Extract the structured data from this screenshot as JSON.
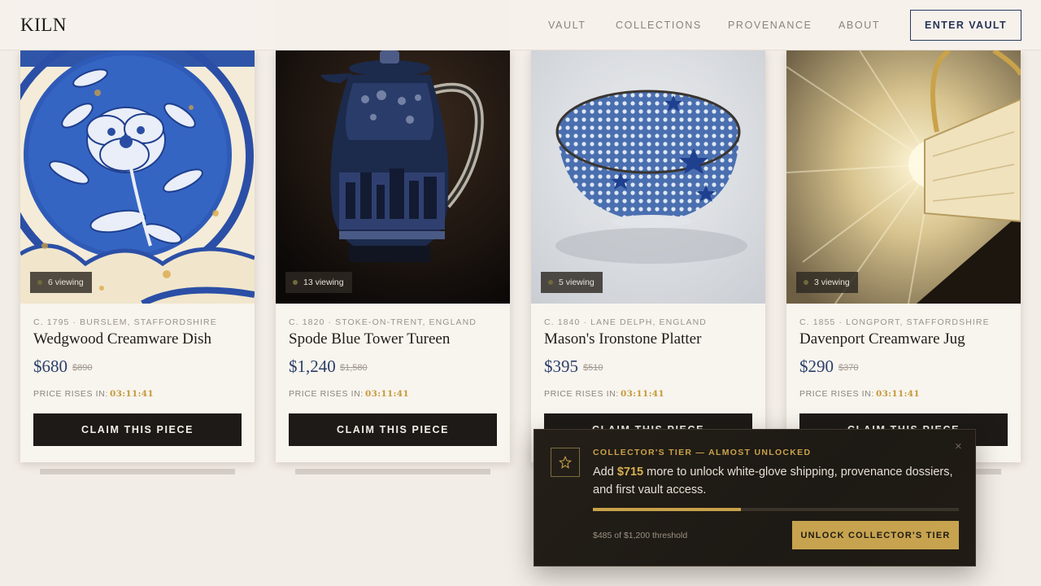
{
  "header": {
    "logo": "KILN",
    "nav": [
      "VAULT",
      "COLLECTIONS",
      "PROVENANCE",
      "ABOUT"
    ],
    "cta": "ENTER VAULT"
  },
  "cards": [
    {
      "image": "blue-white-floral-plate",
      "viewing": "6 viewing",
      "meta": "C. 1795 · BURSLEM, STAFFORDSHIRE",
      "title": "Wedgwood Creamware Dish",
      "price": "$680",
      "old_price": "$890",
      "rise_label": "PRICE RISES IN:",
      "timer": "03:11:41",
      "button": "CLAIM THIS PIECE"
    },
    {
      "image": "blue-white-castle-jug",
      "viewing": "13 viewing",
      "meta": "C. 1820 · STOKE-ON-TRENT, ENGLAND",
      "title": "Spode Blue Tower Tureen",
      "price": "$1,240",
      "old_price": "$1,580",
      "rise_label": "PRICE RISES IN:",
      "timer": "03:11:41",
      "button": "CLAIM THIS PIECE"
    },
    {
      "image": "blue-white-patterned-bowl",
      "viewing": "5 viewing",
      "meta": "C. 1840 · LANE DELPH, ENGLAND",
      "title": "Mason's Ironstone Platter",
      "price": "$395",
      "old_price": "$510",
      "rise_label": "PRICE RISES IN:",
      "timer": "03:11:41",
      "button": "CLAIM THIS PIECE"
    },
    {
      "image": "cream-jug-golden-light",
      "viewing": "3 viewing",
      "meta": "C. 1855 · LONGPORT, STAFFORDSHIRE",
      "title": "Davenport Creamware Jug",
      "price": "$290",
      "old_price": "$370",
      "rise_label": "PRICE RISES IN:",
      "timer": "03:11:41",
      "button": "CLAIM THIS PIECE"
    }
  ],
  "popup": {
    "icon": "star-icon",
    "eyebrow": "COLLECTOR'S TIER — ALMOST UNLOCKED",
    "message_prefix": "Add",
    "message_amount": "$715",
    "message_suffix": "more to unlock white-glove shipping, provenance dossiers, and first vault access.",
    "progress_fraction": 0.404,
    "threshold": "$485 of $1,200 threshold",
    "button": "UNLOCK COLLECTOR'S TIER",
    "close": "×"
  },
  "colors": {
    "accent_gold": "#c9a24a",
    "navy": "#2b3f6a",
    "dark": "#1d1a17",
    "background": "#f3ede7"
  }
}
